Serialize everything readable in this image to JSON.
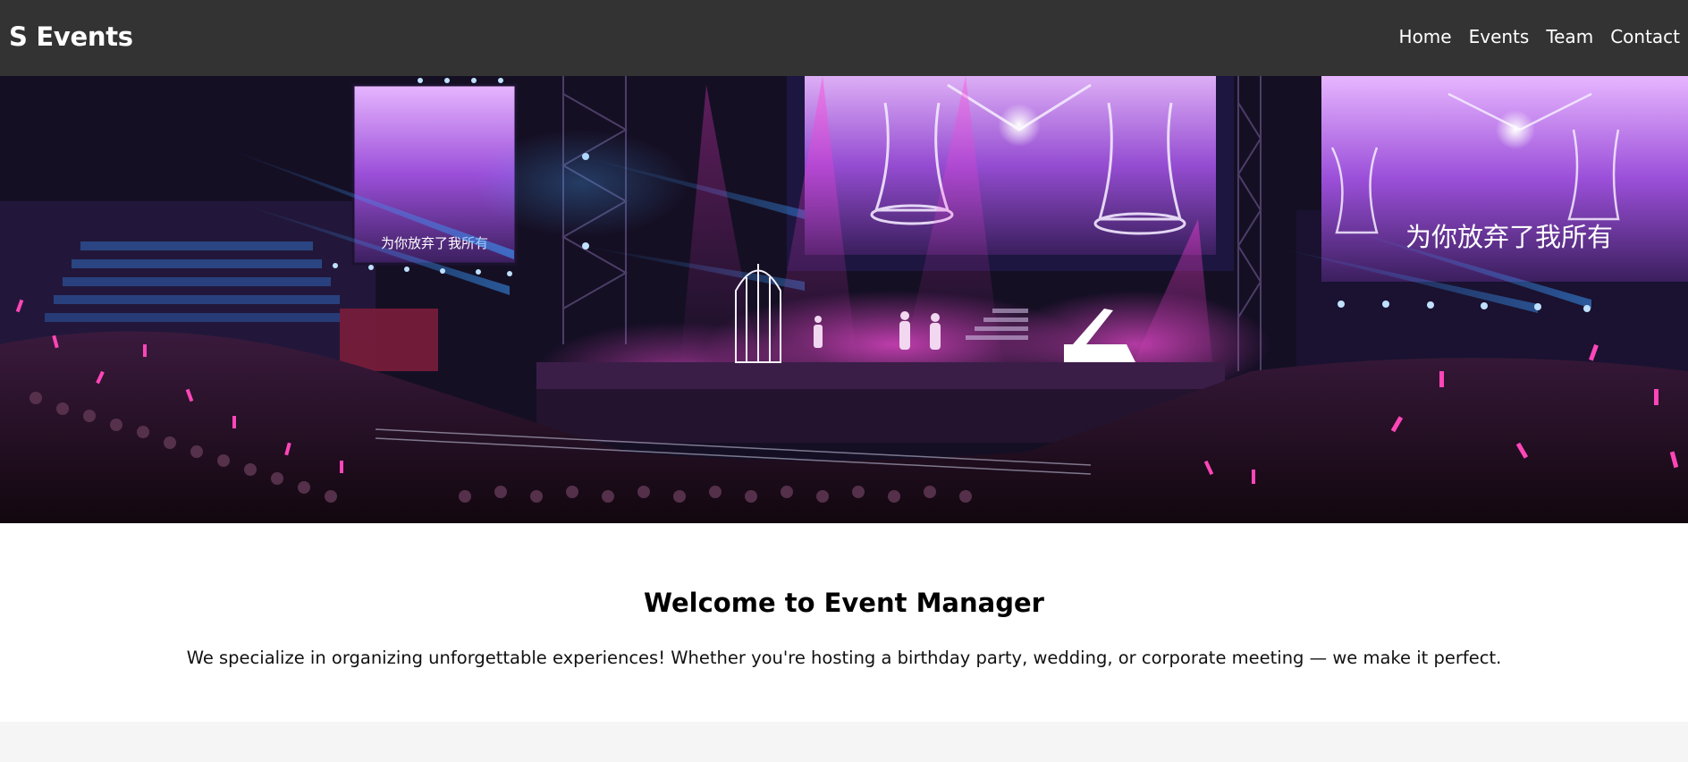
{
  "navbar": {
    "brand": "S Events",
    "links": [
      {
        "label": "Home"
      },
      {
        "label": "Events"
      },
      {
        "label": "Team"
      },
      {
        "label": "Contact"
      }
    ]
  },
  "hero": {
    "image_alt": "Concert stage with purple and pink lights and a large crowd",
    "screen_caption": "为你放弃了我所有",
    "colors": {
      "magenta": "#ff2fd0",
      "blue": "#2a8cff",
      "purple": "#8a4bd6",
      "dark": "#140e26"
    }
  },
  "welcome": {
    "title": "Welcome to Event Manager",
    "text": "We specialize in organizing unforgettable experiences! Whether you're hosting a birthday party, wedding, or corporate meeting — we make it perfect."
  }
}
